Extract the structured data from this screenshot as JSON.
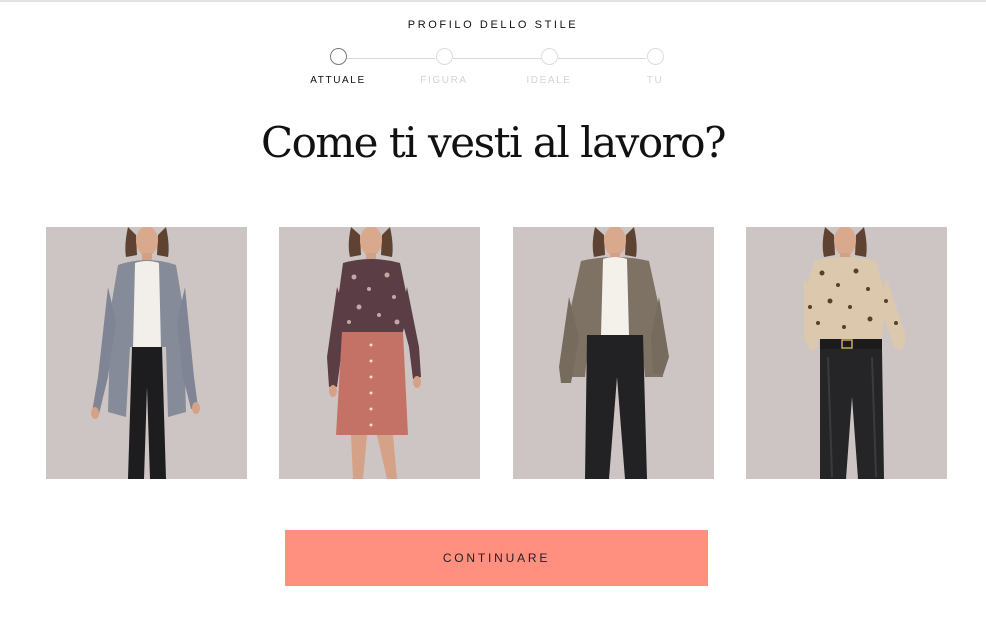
{
  "header": {
    "section_title": "PROFILO DELLO STILE"
  },
  "stepper": {
    "steps": [
      {
        "label": "ATTUALE",
        "state": "active"
      },
      {
        "label": "FIGURA",
        "state": "inactive"
      },
      {
        "label": "IDEALE",
        "state": "inactive"
      },
      {
        "label": "TU",
        "state": "inactive"
      }
    ]
  },
  "question": {
    "text": "Come ti vesti al lavoro?"
  },
  "outfits": [
    {
      "name": "outfit-grey-cardigan",
      "top_color": "#f2efea",
      "outer_color": "#858b98",
      "bottom_color": "#1d1d1f"
    },
    {
      "name": "outfit-floral-blouse-pink-skirt",
      "top_color": "#5a3d45",
      "outer_color": "#5a3d45",
      "bottom_color": "#c57266"
    },
    {
      "name": "outfit-plaid-blazer",
      "top_color": "#f4f1ea",
      "outer_color": "#7d7263",
      "bottom_color": "#222224"
    },
    {
      "name": "outfit-leopard-blouse-leather-pants",
      "top_color": "#dcc8ad",
      "outer_color": "#dcc8ad",
      "bottom_color": "#252527"
    }
  ],
  "actions": {
    "continue_label": "CONTINUARE"
  },
  "colors": {
    "accent": "#ff8f7e",
    "photo_background": "#cdc5c3"
  }
}
